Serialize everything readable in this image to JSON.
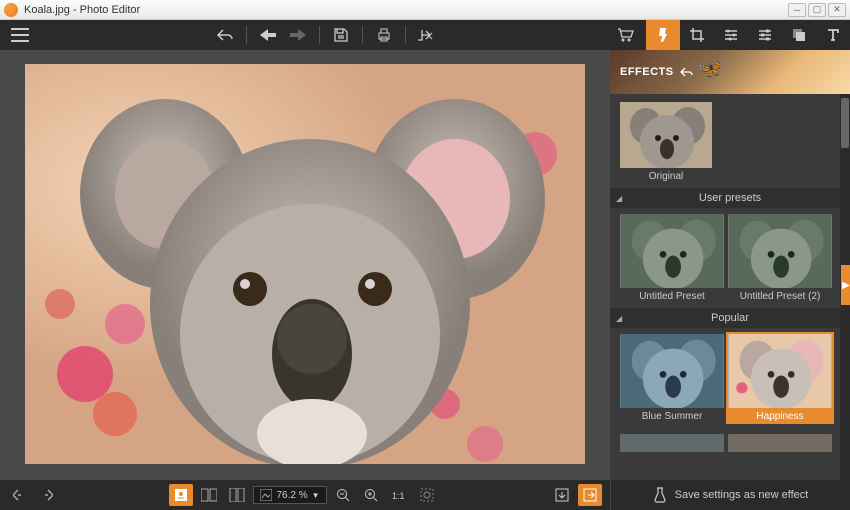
{
  "window": {
    "title": "Koala.jpg - Photo Editor"
  },
  "toolbar": {
    "cart_label": "cart"
  },
  "tabs": {
    "effects": "effects",
    "crop": "crop",
    "adjust": "adjust",
    "settings": "settings",
    "overlay": "overlay",
    "text": "text"
  },
  "panel": {
    "header": "EFFECTS",
    "original_label": "Original",
    "sections": [
      {
        "title": "User presets",
        "items": [
          {
            "label": "Untitled Preset",
            "selected": false
          },
          {
            "label": "Untitled Preset (2)",
            "selected": false
          }
        ]
      },
      {
        "title": "Popular",
        "items": [
          {
            "label": "Blue Summer",
            "selected": false
          },
          {
            "label": "Happiness",
            "selected": true
          }
        ]
      }
    ],
    "footer": "Save settings as new effect"
  },
  "bottombar": {
    "zoom": "76.2 %"
  },
  "colors": {
    "accent": "#e78b2e"
  }
}
